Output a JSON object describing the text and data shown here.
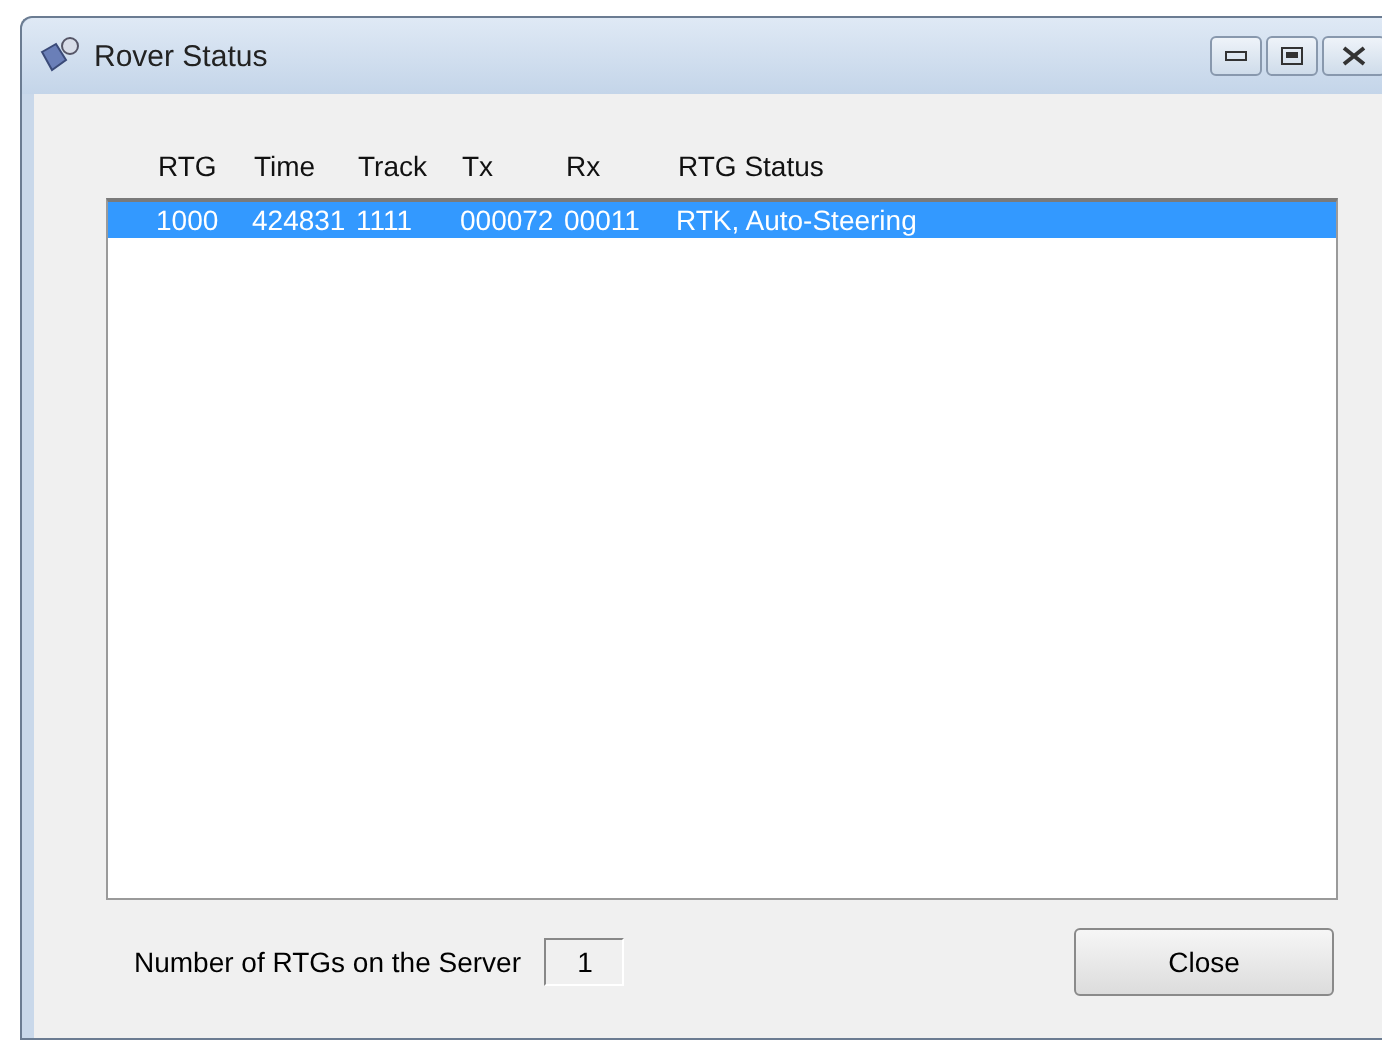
{
  "window": {
    "title": "Rover Status"
  },
  "table": {
    "columns": [
      "RTG",
      "Time",
      "Track",
      "Tx",
      "Rx",
      "RTG Status"
    ],
    "rows": [
      {
        "cells": [
          "1000",
          "424831",
          "1111",
          "000072",
          "00011",
          "RTK, Auto-Steering"
        ],
        "selected": true
      }
    ]
  },
  "footer": {
    "label": "Number of RTGs on the Server",
    "count": "1",
    "button": "Close"
  }
}
